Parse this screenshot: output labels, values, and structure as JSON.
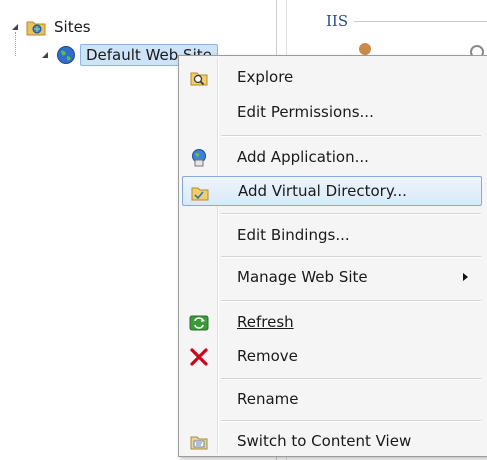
{
  "tree": {
    "sites_label": "Sites",
    "site_label": "Default Web Site"
  },
  "panel": {
    "section_label": "IIS"
  },
  "context_menu": {
    "explore": "Explore",
    "edit_permissions": "Edit Permissions...",
    "add_application": "Add Application...",
    "add_virtual_directory": "Add Virtual Directory...",
    "edit_bindings": "Edit Bindings...",
    "manage_web_site": "Manage Web Site",
    "refresh": "Refresh",
    "remove": "Remove",
    "rename": "Rename",
    "switch_to_content_view": "Switch to Content View"
  },
  "icons": {
    "explore": "folder-search-icon",
    "add_application": "application-icon",
    "add_virtual_directory": "virtual-directory-icon",
    "refresh": "refresh-icon",
    "remove": "remove-x-icon",
    "switch": "content-view-icon",
    "sites": "sites-folder-icon",
    "site": "globe-icon"
  },
  "colors": {
    "highlight_border": "#84acdd",
    "remove_red": "#d0021b",
    "refresh_green": "#3c9a3a"
  }
}
